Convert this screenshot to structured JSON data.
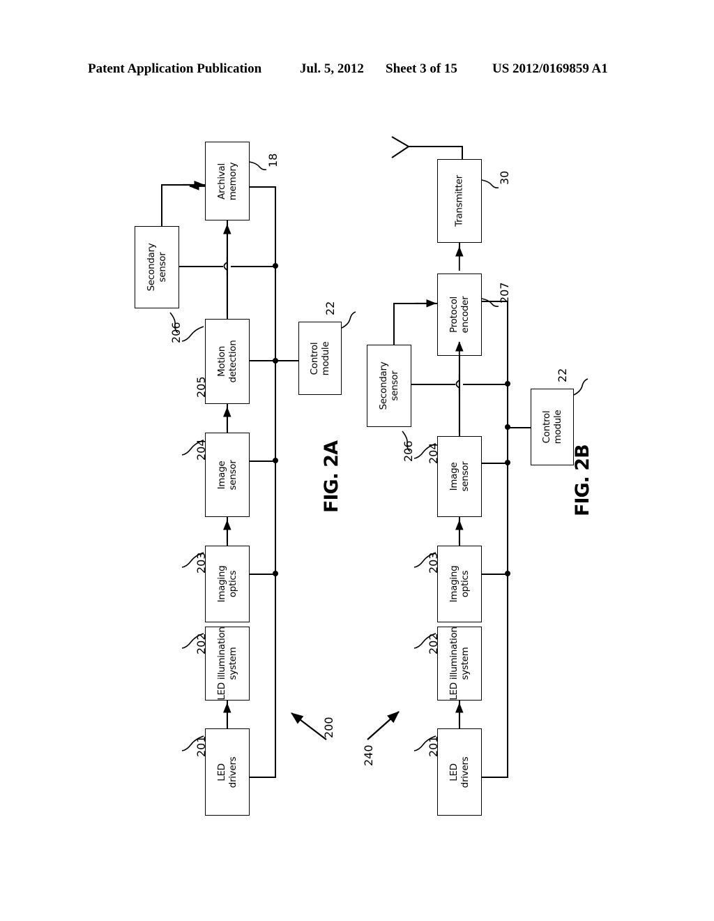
{
  "header": {
    "publication": "Patent Application Publication",
    "date": "Jul. 5, 2012",
    "sheet": "Sheet 3 of 15",
    "patent_number": "US 2012/0169859 A1"
  },
  "figures": [
    {
      "id": "fig2a",
      "caption": "FIG. 2A",
      "system_ref": "200",
      "blocks": [
        {
          "key": "led_drivers",
          "label_line1": "LED",
          "label_line2": "drivers",
          "ref": "201"
        },
        {
          "key": "led_illumination",
          "label_line1": "LED illumination",
          "label_line2": "system",
          "ref": "202"
        },
        {
          "key": "imaging_optics",
          "label_line1": "Imaging",
          "label_line2": "optics",
          "ref": "203"
        },
        {
          "key": "image_sensor",
          "label_line1": "Image",
          "label_line2": "sensor",
          "ref": "204"
        },
        {
          "key": "motion_detection",
          "label_line1": "Motion",
          "label_line2": "detection",
          "ref": "205"
        },
        {
          "key": "secondary_sensor",
          "label_line1": "Secondary",
          "label_line2": "sensor",
          "ref": "206"
        },
        {
          "key": "archival_memory",
          "label_line1": "Archival",
          "label_line2": "memory",
          "ref": "18"
        },
        {
          "key": "control_module",
          "label_line1": "Control",
          "label_line2": "module",
          "ref": "22"
        }
      ]
    },
    {
      "id": "fig2b",
      "caption": "FIG. 2B",
      "system_ref": "240",
      "blocks": [
        {
          "key": "led_drivers",
          "label_line1": "LED",
          "label_line2": "drivers",
          "ref": "201"
        },
        {
          "key": "led_illumination",
          "label_line1": "LED illumination",
          "label_line2": "system",
          "ref": "202"
        },
        {
          "key": "imaging_optics",
          "label_line1": "Imaging",
          "label_line2": "optics",
          "ref": "203"
        },
        {
          "key": "image_sensor",
          "label_line1": "Image",
          "label_line2": "sensor",
          "ref": "204"
        },
        {
          "key": "secondary_sensor",
          "label_line1": "Secondary",
          "label_line2": "sensor",
          "ref": "206"
        },
        {
          "key": "protocol_encoder",
          "label_line1": "Protocol",
          "label_line2": "encoder",
          "ref": "207"
        },
        {
          "key": "transmitter",
          "label_line1": "Transmitter",
          "label_line2": "",
          "ref": "30"
        },
        {
          "key": "control_module",
          "label_line1": "Control",
          "label_line2": "module",
          "ref": "22"
        }
      ]
    }
  ],
  "colors": {
    "ink": "#000000",
    "paper": "#ffffff"
  }
}
